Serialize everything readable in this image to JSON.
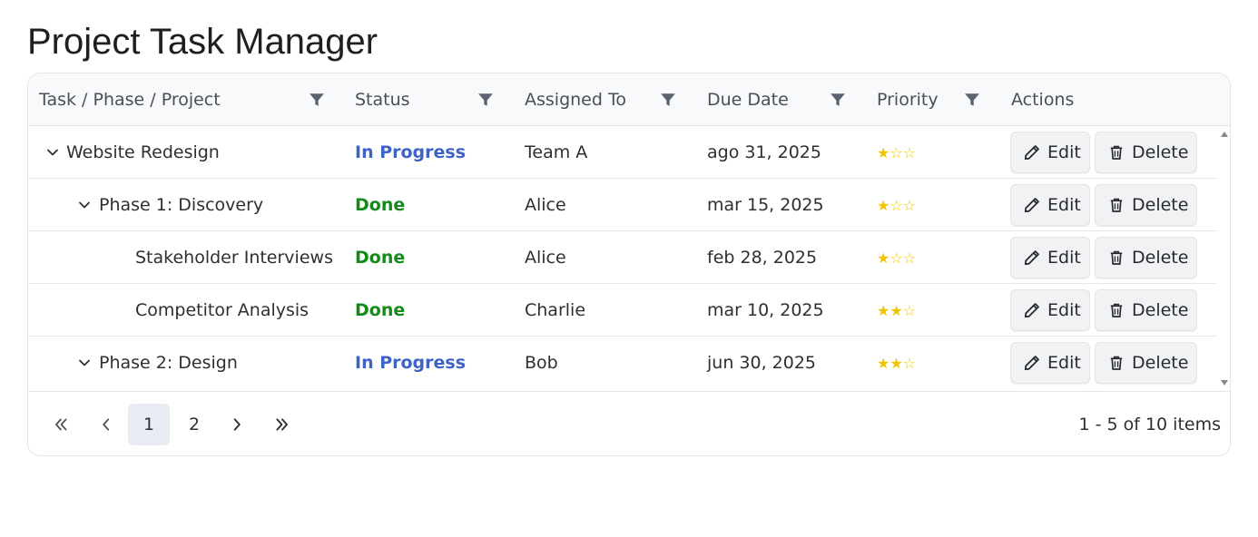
{
  "page": {
    "title": "Project Task Manager"
  },
  "columns": [
    {
      "label": "Task / Phase / Project",
      "filterable": true
    },
    {
      "label": "Status",
      "filterable": true
    },
    {
      "label": "Assigned To",
      "filterable": true
    },
    {
      "label": "Due Date",
      "filterable": true
    },
    {
      "label": "Priority",
      "filterable": true
    },
    {
      "label": "Actions",
      "filterable": false
    }
  ],
  "rows": [
    {
      "name": "Website Redesign",
      "level": 0,
      "expandable": true,
      "status": "In Progress",
      "assigned": "Team A",
      "due": "ago 31, 2025",
      "priority": 1,
      "stars": "★☆☆"
    },
    {
      "name": "Phase 1: Discovery",
      "level": 1,
      "expandable": true,
      "status": "Done",
      "assigned": "Alice",
      "due": "mar 15, 2025",
      "priority": 1,
      "stars": "★☆☆"
    },
    {
      "name": "Stakeholder Interviews",
      "level": 2,
      "expandable": false,
      "status": "Done",
      "assigned": "Alice",
      "due": "feb 28, 2025",
      "priority": 1,
      "stars": "★☆☆"
    },
    {
      "name": "Competitor Analysis",
      "level": 2,
      "expandable": false,
      "status": "Done",
      "assigned": "Charlie",
      "due": "mar 10, 2025",
      "priority": 2,
      "stars": "★★☆"
    },
    {
      "name": "Phase 2: Design",
      "level": 1,
      "expandable": true,
      "status": "In Progress",
      "assigned": "Bob",
      "due": "jun 30, 2025",
      "priority": 2,
      "stars": "★★☆"
    }
  ],
  "actions": {
    "edit_label": "Edit",
    "delete_label": "Delete"
  },
  "pager": {
    "pages": [
      "1",
      "2"
    ],
    "current": "1",
    "info": "1 - 5 of 10 items"
  },
  "colors": {
    "in_progress": "#3d63c9",
    "done": "#148a1a",
    "star": "#f2c300",
    "header_bg": "#f8f9fb"
  }
}
